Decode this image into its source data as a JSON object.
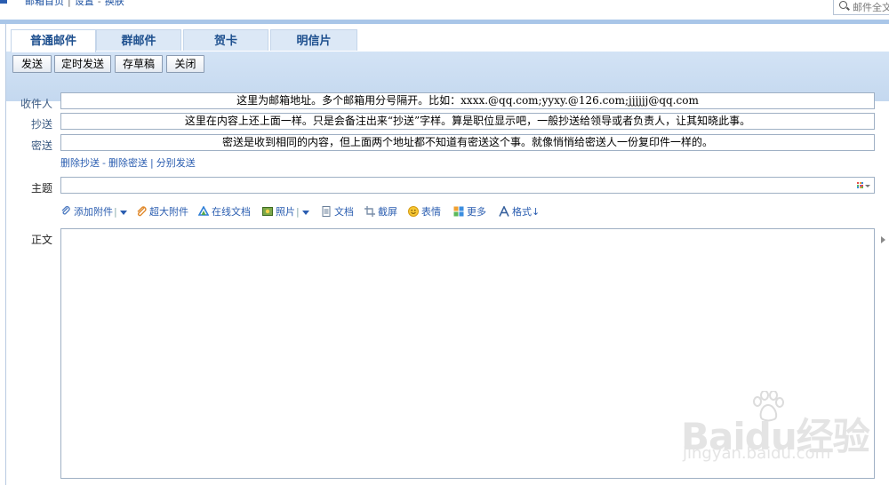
{
  "top_nav": {
    "links": [
      "邮箱首页",
      "设置",
      "换肤"
    ],
    "search_placeholder": "邮件全文"
  },
  "tabs": [
    {
      "label": "普通邮件",
      "active": true
    },
    {
      "label": "群邮件",
      "active": false
    },
    {
      "label": "贺卡",
      "active": false
    },
    {
      "label": "明信片",
      "active": false
    }
  ],
  "toolbar": {
    "send": "发送",
    "scheduled_send": "定时发送",
    "save_draft": "存草稿",
    "close": "关闭"
  },
  "compose": {
    "to_label": "收件人",
    "to_value": "这里为邮箱地址。多个邮箱用分号隔开。比如：xxxx.@qq.com;yyxy.@126.com;jjjjjj@qq.com",
    "cc_label": "抄送",
    "cc_value": "这里在内容上还上面一样。只是会备注出来“抄送”字样。算是职位显示吧，一般抄送给领导或者负责人，让其知晓此事。",
    "bcc_label": "密送",
    "bcc_value": "密送是收到相同的内容，但上面两个地址都不知道有密送这个事。就像悄悄给密送人一份复印件一样的。",
    "cc_ops": [
      "删除抄送",
      "删除密送",
      "分别发送"
    ],
    "subject_label": "主题",
    "subject_value": "",
    "body_label": "正文"
  },
  "attach_tools": [
    {
      "label": "添加附件",
      "icon": "paperclip-icon",
      "dropdown": true
    },
    {
      "label": "超大附件",
      "icon": "large-paperclip-icon",
      "dropdown": false
    },
    {
      "label": "在线文档",
      "icon": "cloud-doc-icon",
      "dropdown": false
    },
    {
      "label": "照片",
      "icon": "photo-icon",
      "dropdown": true
    },
    {
      "label": "文档",
      "icon": "document-icon",
      "dropdown": false
    },
    {
      "label": "截屏",
      "icon": "screenshot-icon",
      "dropdown": false
    },
    {
      "label": "表情",
      "icon": "smiley-icon",
      "dropdown": false
    },
    {
      "label": "更多",
      "icon": "more-grid-icon",
      "dropdown": false
    },
    {
      "label": "格式",
      "icon": "format-text-icon",
      "dropdown": false
    }
  ],
  "watermark": {
    "brand": "Baidu经验",
    "url": "jingyan.baidu.com"
  },
  "colors": {
    "accent": "#2a5db0",
    "tab_text": "#1d4f8e",
    "band": "#c4d8ef"
  }
}
